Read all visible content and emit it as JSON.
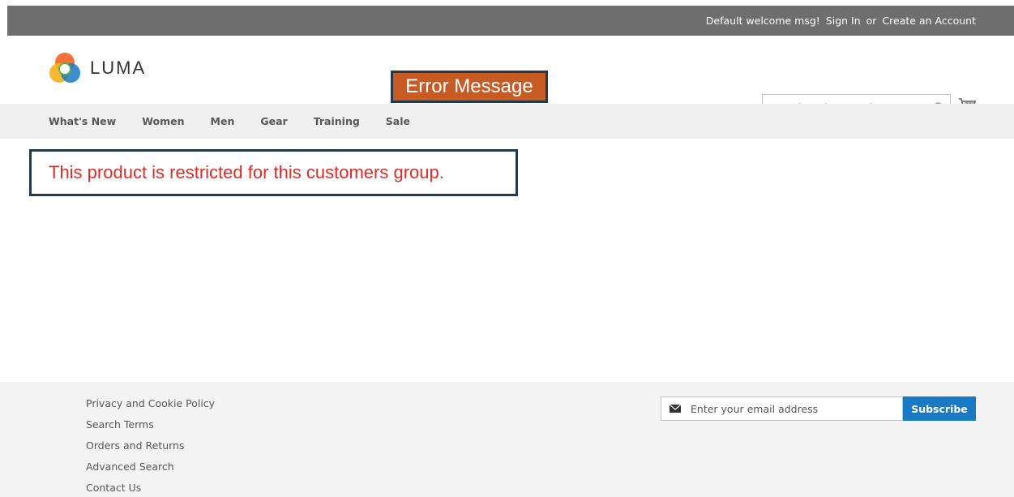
{
  "panel": {
    "welcome": "Default welcome msg!",
    "sign_in": "Sign In",
    "or": "or",
    "create_account": "Create an Account"
  },
  "header": {
    "logo_text": "LUMA",
    "annotation_label": "Error Message",
    "search_placeholder": "Search entire store here...",
    "search_icon": "search-icon",
    "cart_icon": "cart-icon"
  },
  "nav": {
    "items": [
      "What's New",
      "Women",
      "Men",
      "Gear",
      "Training",
      "Sale"
    ]
  },
  "main": {
    "error_message": "This product is restricted for this customers group."
  },
  "footer": {
    "links": [
      "Privacy and Cookie Policy",
      "Search Terms",
      "Orders and Returns",
      "Advanced Search",
      "Contact Us"
    ],
    "email_placeholder": "Enter your email address",
    "subscribe_label": "Subscribe",
    "mail_icon": "envelope-icon"
  },
  "colors": {
    "panel_bg": "#6e6e6e",
    "nav_bg": "#f0f0f0",
    "error_text": "#e02b27",
    "annotation_bg": "#c75b24",
    "annotation_border": "#1f3b4d",
    "subscribe_bg": "#1979c3",
    "footer_bg": "#f4f4f4"
  }
}
